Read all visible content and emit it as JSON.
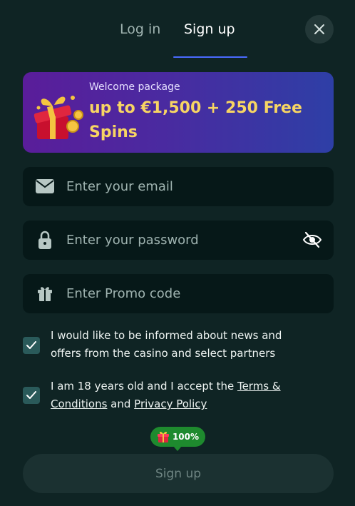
{
  "tabs": {
    "login": "Log in",
    "signup": "Sign up",
    "active": "signup"
  },
  "banner": {
    "subtitle": "Welcome package",
    "title": "up to €1,500 + 250 Free Spins"
  },
  "fields": {
    "email_placeholder": "Enter your email",
    "password_placeholder": "Enter your password",
    "promo_placeholder": "Enter Promo code"
  },
  "consents": {
    "news_text": "I would like to be informed about news and offers from the casino and select partners",
    "news_checked": true,
    "age_prefix": "I am 18 years old and I accept the ",
    "terms_link": "Terms & Conditions",
    "and_word": " and ",
    "privacy_link": "Privacy Policy",
    "age_checked": true
  },
  "promo_badge": {
    "value": "100%"
  },
  "submit": {
    "label": "Sign up"
  },
  "colors": {
    "background": "#0f2424",
    "field_bg": "#061818",
    "accent_underline": "#4a6bff",
    "banner_title": "#f7d563",
    "checkbox": "#2a5a5a",
    "badge": "#1e8a2e"
  },
  "icons": [
    "close-icon",
    "gift-box-art",
    "envelope-icon",
    "lock-icon",
    "eye-off-icon",
    "gift-icon",
    "check-icon"
  ]
}
